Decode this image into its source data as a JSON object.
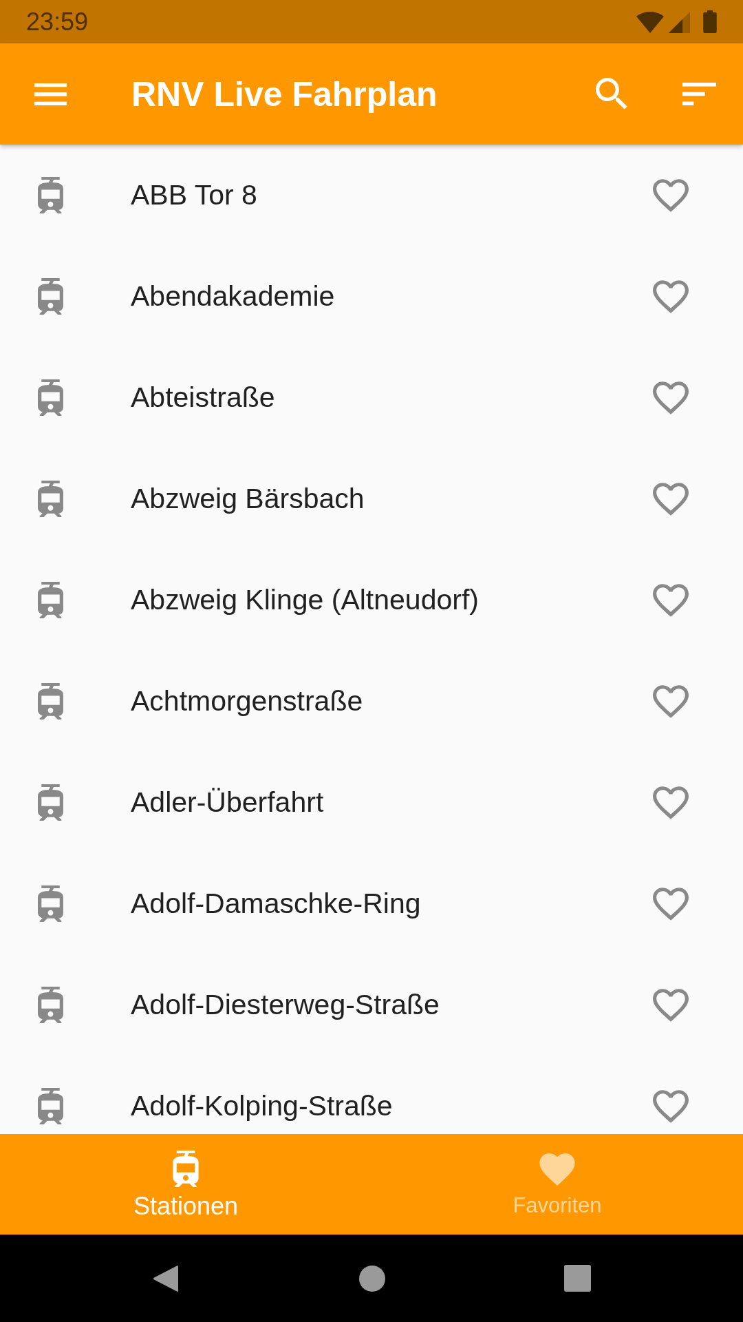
{
  "status_bar": {
    "time": "23:59"
  },
  "app_bar": {
    "title": "RNV Live Fahrplan"
  },
  "stations": [
    {
      "name": "ABB Tor 8",
      "favorite": false
    },
    {
      "name": "Abendakademie",
      "favorite": false
    },
    {
      "name": "Abteistraße",
      "favorite": false
    },
    {
      "name": "Abzweig Bärsbach",
      "favorite": false
    },
    {
      "name": "Abzweig Klinge (Altneudorf)",
      "favorite": false
    },
    {
      "name": "Achtmorgenstraße",
      "favorite": false
    },
    {
      "name": "Adler-Überfahrt",
      "favorite": false
    },
    {
      "name": "Adolf-Damaschke-Ring",
      "favorite": false
    },
    {
      "name": "Adolf-Diesterweg-Straße",
      "favorite": false
    },
    {
      "name": "Adolf-Kolping-Straße",
      "favorite": false
    }
  ],
  "bottom_nav": [
    {
      "label": "Stationen",
      "selected": true
    },
    {
      "label": "Favoriten",
      "selected": false
    }
  ]
}
